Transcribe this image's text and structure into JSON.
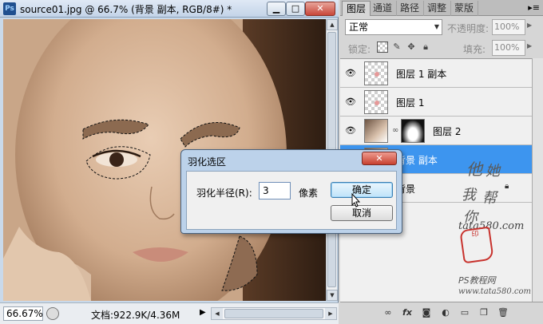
{
  "document": {
    "app_icon": "Ps",
    "title": "source01.jpg @ 66.7% (背景 副本, RGB/8#) *",
    "window_buttons": {
      "minimize": "▁",
      "maximize": "□",
      "close": "✕"
    },
    "zoom": "66.67%",
    "doc_size": "文档:922.9K/4.36M",
    "status_arrow": "▶"
  },
  "layers_panel": {
    "tabs": [
      "图层",
      "通道",
      "路径",
      "调整",
      "蒙版"
    ],
    "active_tab": "图层",
    "menu_icon": "▸≡",
    "blend_mode": "正常",
    "opacity_label": "不透明度:",
    "opacity_value": "100%",
    "lock_label": "锁定:",
    "fill_label": "填充:",
    "fill_value": "100%",
    "layers": [
      {
        "name": "图层 1 副本",
        "visible": true,
        "selected": false
      },
      {
        "name": "图层 1",
        "visible": true,
        "selected": false
      },
      {
        "name": "图层 2",
        "visible": true,
        "selected": false,
        "has_mask": true
      },
      {
        "name": "背景 副本",
        "visible": true,
        "selected": true
      },
      {
        "name": "背景",
        "visible": true,
        "selected": false,
        "locked": true
      }
    ],
    "footer_icons": [
      "link-icon",
      "fx-icon",
      "mask-icon",
      "adjustment-icon",
      "group-icon",
      "new-layer-icon",
      "trash-icon"
    ]
  },
  "feather_dialog": {
    "title": "羽化选区",
    "close_label": "✕",
    "radius_label": "羽化半径(R):",
    "radius_value": "3",
    "unit": "像素",
    "ok_label": "确定",
    "cancel_label": "取消"
  },
  "watermark": {
    "chars": [
      "他",
      "她",
      "我",
      "帮",
      "你"
    ],
    "site": "tata580.com",
    "seal": "印",
    "ps_text": "PS教程网",
    "url": "www.tata580.com"
  },
  "colors": {
    "selection_blue": "#3d95ef",
    "dialog_frame": "#bcd2ea",
    "close_red": "#c7412f"
  }
}
